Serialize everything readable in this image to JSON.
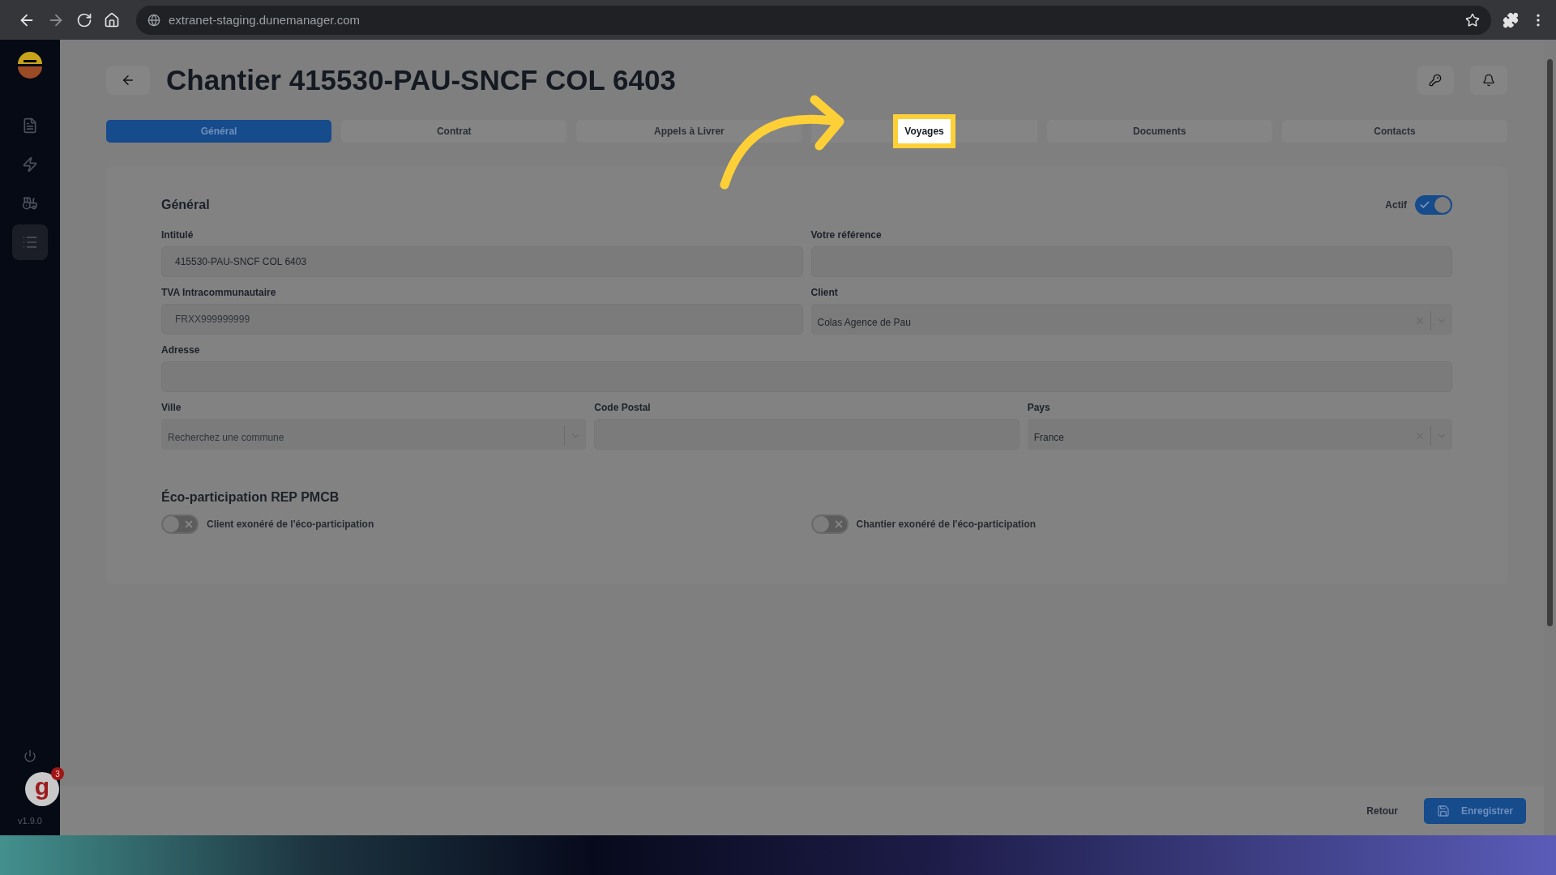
{
  "browser": {
    "url": "extranet-staging.dunemanager.com"
  },
  "sidebar": {
    "items": [
      {
        "kind": "document",
        "selected": false
      },
      {
        "kind": "bolt",
        "selected": false
      },
      {
        "kind": "vehicle",
        "selected": false
      },
      {
        "kind": "list",
        "selected": true
      }
    ],
    "help_badge": {
      "letter": "g",
      "count": "3"
    },
    "version": "v1.9.0"
  },
  "page": {
    "title": "Chantier 415530-PAU-SNCF COL 6403",
    "tabs": [
      {
        "label": "Général",
        "selected": true,
        "highlighted": false
      },
      {
        "label": "Contrat",
        "selected": false,
        "highlighted": false
      },
      {
        "label": "Appels à Livrer",
        "selected": false,
        "highlighted": false
      },
      {
        "label": "Voyages",
        "selected": false,
        "highlighted": true
      },
      {
        "label": "Documents",
        "selected": false,
        "highlighted": false
      },
      {
        "label": "Contacts",
        "selected": false,
        "highlighted": false
      }
    ]
  },
  "general": {
    "title": "Général",
    "active_toggle": {
      "label": "Actif",
      "on": true
    },
    "rows": [
      [
        {
          "kind": "text",
          "label": "Intitulé",
          "value": "415530-PAU-SNCF COL 6403"
        },
        {
          "kind": "text",
          "label": "Votre référence"
        }
      ],
      [
        {
          "kind": "text",
          "label": "TVA Intracommunautaire",
          "placeholder": "FRXX999999999"
        },
        {
          "kind": "select",
          "label": "Client",
          "value": "Colas Agence de Pau"
        }
      ],
      [
        {
          "kind": "text",
          "label": "Adresse"
        }
      ],
      [
        {
          "kind": "select",
          "label": "Ville",
          "placeholder": "Recherchez une commune"
        },
        {
          "kind": "text",
          "label": "Code Postal"
        },
        {
          "kind": "select",
          "label": "Pays",
          "value": "France"
        }
      ]
    ]
  },
  "eco": {
    "title": "Éco-participation REP PMCB",
    "toggles": [
      {
        "label": "Client exonéré de l'éco-participation",
        "on": false
      },
      {
        "label": "Chantier exonéré de l'éco-participation",
        "on": false
      }
    ]
  },
  "footer": {
    "buttons": [
      {
        "kind": "link",
        "label": "Retour"
      },
      {
        "kind": "primary",
        "label": "Enregistrer"
      }
    ]
  }
}
